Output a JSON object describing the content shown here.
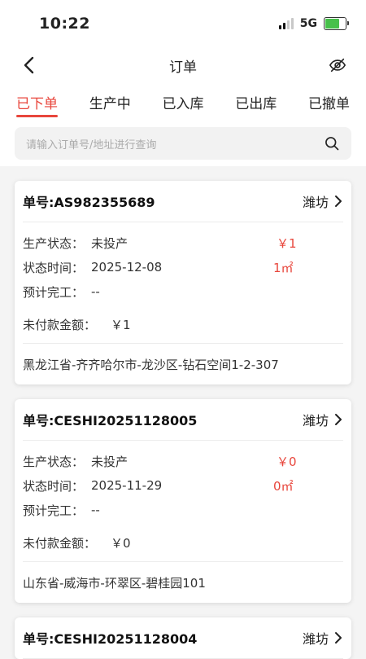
{
  "status_bar": {
    "time": "10:22",
    "network": "5G"
  },
  "header": {
    "title": "订单"
  },
  "tabs": [
    {
      "label": "已下单",
      "active": true
    },
    {
      "label": "生产中",
      "active": false
    },
    {
      "label": "已入库",
      "active": false
    },
    {
      "label": "已出库",
      "active": false
    },
    {
      "label": "已撤单",
      "active": false
    }
  ],
  "search": {
    "placeholder": "请输入订单号/地址进行查询"
  },
  "labels": {
    "production_status": "生产状态：",
    "status_time": "状态时间：",
    "est_completion": "预计完工：",
    "unpaid_amount": "未付款金额："
  },
  "orders": [
    {
      "order_no": "单号:AS982355689",
      "city": "潍坊",
      "production_status": "未投产",
      "amount": "￥1",
      "status_time": "2025-12-08",
      "area": "1㎡",
      "est_completion": "--",
      "unpaid": "￥1",
      "address": "黑龙江省-齐齐哈尔市-龙沙区-钻石空间1-2-307"
    },
    {
      "order_no": "单号:CESHI20251128005",
      "city": "潍坊",
      "production_status": "未投产",
      "amount": "￥0",
      "status_time": "2025-11-29",
      "area": "0㎡",
      "est_completion": "--",
      "unpaid": "￥0",
      "address": "山东省-威海市-环翠区-碧桂园101"
    },
    {
      "order_no": "单号:CESHI20251128004",
      "city": "潍坊"
    }
  ],
  "colors": {
    "accent": "#e8463c",
    "battery": "#47c04a"
  }
}
